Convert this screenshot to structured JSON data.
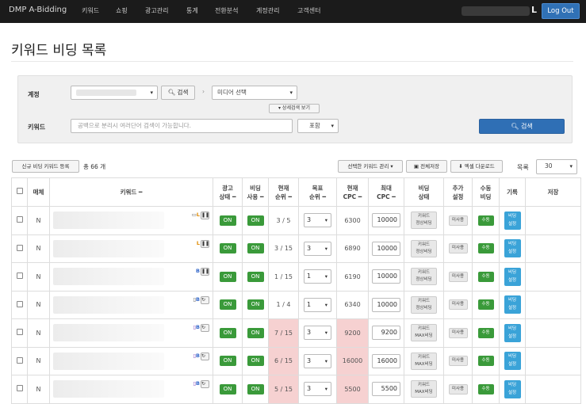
{
  "nav": {
    "brand": "DMP A-Bidding",
    "items": [
      "키워드",
      "쇼핑",
      "광고관리",
      "통계",
      "전환분석",
      "계정관리",
      "고객센터"
    ],
    "logout": "Log Out"
  },
  "page_title": "키워드 비딩 목록",
  "filter": {
    "account_label": "계정",
    "search_btn": "검색",
    "media_select": "미디어 선택",
    "detail_toggle": "▾ 상세검색 보기",
    "keyword_label": "키워드",
    "keyword_placeholder": "공백으로 분리시 여러단어 검색이 가능합니다.",
    "match_select": "포함",
    "main_search_btn": "검색"
  },
  "toolbar": {
    "new_bid": "신규 비딩 키워드 등록",
    "total": "총 66 개",
    "selected_mgmt": "선택한 키워드 관리 ▾",
    "save_all": "전체저장",
    "excel": "엑셀 다운로드",
    "per_page_label": "목록",
    "per_page_value": "30"
  },
  "table": {
    "headers": [
      "",
      "매체",
      "키워드 ━",
      "광고\n상태 ━",
      "비딩\n사용 ━",
      "현재\n순위 ━",
      "목표\n순위 ━",
      "현재\nCPC ━",
      "최대\nCPC ━",
      "비딩\n상태",
      "추가\n설정",
      "수동\n비딩",
      "기록",
      "저장"
    ],
    "rows": [
      {
        "media": "N",
        "ad": "ON",
        "bid_use": "ON",
        "rank": "3 / 5",
        "target": "3",
        "cpc": "6300",
        "max": "10000",
        "status1": "키워드",
        "status2": "정상비딩",
        "extra": "미사용",
        "manual": "수동",
        "log1": "비딩",
        "log2": "설정",
        "flags": "L",
        "pink": false
      },
      {
        "media": "N",
        "ad": "ON",
        "bid_use": "ON",
        "rank": "3 / 15",
        "target": "3",
        "cpc": "6890",
        "max": "10000",
        "status1": "키워드",
        "status2": "정상비딩",
        "extra": "미사용",
        "manual": "수동",
        "log1": "비딩",
        "log2": "설정",
        "flags": "L",
        "pink": false
      },
      {
        "media": "N",
        "ad": "ON",
        "bid_use": "ON",
        "rank": "1 / 15",
        "target": "1",
        "cpc": "6190",
        "max": "10000",
        "status1": "키워드",
        "status2": "정상비딩",
        "extra": "미사용",
        "manual": "수동",
        "log1": "비딩",
        "log2": "설정",
        "flags": "B",
        "pink": false
      },
      {
        "media": "N",
        "ad": "ON",
        "bid_use": "ON",
        "rank": "1 / 4",
        "target": "1",
        "cpc": "6340",
        "max": "10000",
        "status1": "키워드",
        "status2": "정상비딩",
        "extra": "미사용",
        "manual": "수동",
        "log1": "비딩",
        "log2": "설정",
        "flags": "B",
        "pink": false
      },
      {
        "media": "N",
        "ad": "ON",
        "bid_use": "ON",
        "rank": "7 / 15",
        "target": "3",
        "cpc": "9200",
        "max": "9200",
        "status1": "키워드",
        "status2": "MAX비딩",
        "extra": "미사용",
        "manual": "수동",
        "log1": "비딩",
        "log2": "설정",
        "flags": "B",
        "pink": true
      },
      {
        "media": "N",
        "ad": "ON",
        "bid_use": "ON",
        "rank": "6 / 15",
        "target": "3",
        "cpc": "16000",
        "max": "16000",
        "status1": "키워드",
        "status2": "MAX비딩",
        "extra": "미사용",
        "manual": "수동",
        "log1": "비딩",
        "log2": "설정",
        "flags": "B",
        "pink": true
      },
      {
        "media": "N",
        "ad": "ON",
        "bid_use": "ON",
        "rank": "5 / 15",
        "target": "3",
        "cpc": "5500",
        "max": "5500",
        "status1": "키워드",
        "status2": "MAX비딩",
        "extra": "미사용",
        "manual": "수동",
        "log1": "비딩",
        "log2": "설정",
        "flags": "B",
        "pink": true
      }
    ]
  }
}
